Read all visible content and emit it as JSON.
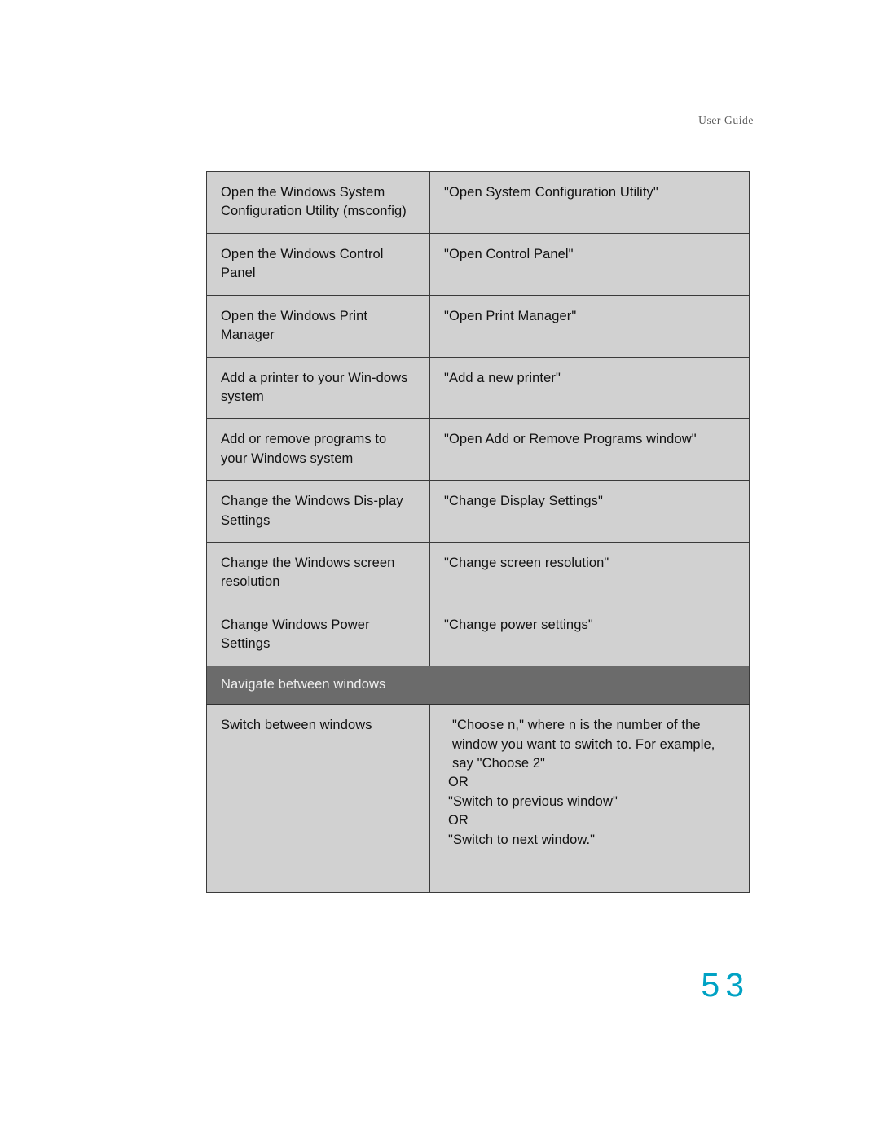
{
  "page": {
    "running_header": "User Guide",
    "folio": "53",
    "folio_color": "#00a2c4",
    "cell_background": "#d1d1d1",
    "section_header_background": "#6b6b6b"
  },
  "table": {
    "rows": [
      {
        "type": "data",
        "task": "Open the Windows System Configuration Utility (msconfig)",
        "command": "\"Open System Configuration Utility\""
      },
      {
        "type": "data",
        "task": "Open the Windows Control Panel",
        "command": "\"Open Control Panel\""
      },
      {
        "type": "data",
        "task": "Open the Windows Print Manager",
        "command": "\"Open Print Manager\""
      },
      {
        "type": "data",
        "task": "Add a printer to your Win-dows system",
        "command": "\"Add a new printer\""
      },
      {
        "type": "data",
        "task": "Add or remove programs to your Windows system",
        "command": "\"Open Add or Remove Programs window\""
      },
      {
        "type": "data",
        "task": "Change the Windows Dis-play Settings",
        "command": "\"Change Display Settings\""
      },
      {
        "type": "data",
        "task": "Change the Windows screen resolution",
        "command": "\"Change screen resolution\""
      },
      {
        "type": "data",
        "task": "Change Windows Power Settings",
        "command": "\"Change power settings\""
      },
      {
        "type": "section",
        "title": "Navigate between windows"
      },
      {
        "type": "data",
        "task": "Switch between windows",
        "command_lines": [
          "\"Choose n,\" where n is the number of the window you want to switch to. For example, say \"Choose 2\"",
          "OR",
          "\"Switch to previous window\"",
          "OR",
          "\"Switch to next window.\""
        ]
      }
    ]
  }
}
